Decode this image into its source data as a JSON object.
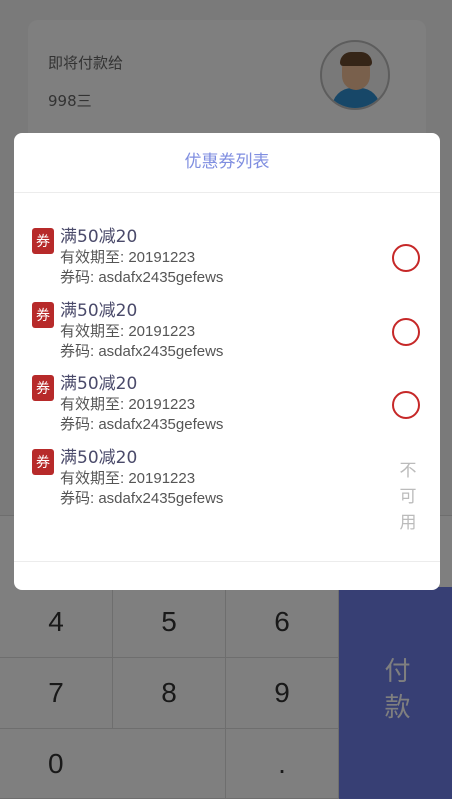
{
  "payee": {
    "label": "即将付款给",
    "name": "998三"
  },
  "keypad": {
    "keys": [
      "4",
      "5",
      "6",
      "7",
      "8",
      "9",
      "0",
      "."
    ],
    "pay_label": "付款",
    "pay_color": "#6f7fe8"
  },
  "modal": {
    "title": "优惠券列表",
    "title_color": "#7f8ee0",
    "coupons": [
      {
        "badge": "券",
        "name": "满50减20",
        "expiry": "有效期至: 20191223",
        "code": "券码: asdafx2435gefews",
        "status": "available"
      },
      {
        "badge": "券",
        "name": "满50减20",
        "expiry": "有效期至: 20191223",
        "code": "券码: asdafx2435gefews",
        "status": "available"
      },
      {
        "badge": "券",
        "name": "满50减20",
        "expiry": "有效期至: 20191223",
        "code": "券码: asdafx2435gefews",
        "status": "available"
      },
      {
        "badge": "券",
        "name": "满50减20",
        "expiry": "有效期至: 20191223",
        "code": "券码: asdafx2435gefews",
        "status": "unavailable",
        "status_text": "不可用"
      }
    ],
    "badge_color": "#b72a2a",
    "radio_color": "#c62828"
  },
  "icons": {
    "avatar": "user-avatar-icon"
  }
}
